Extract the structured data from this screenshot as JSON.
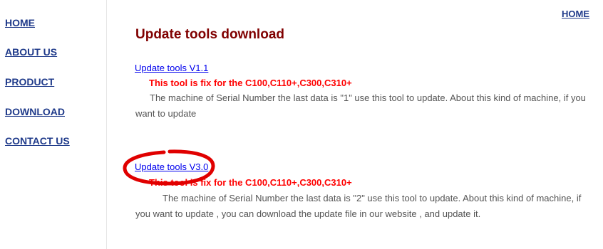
{
  "sidebar": {
    "items": [
      {
        "label": "HOME"
      },
      {
        "label": "ABOUT US"
      },
      {
        "label": "PRODUCT"
      },
      {
        "label": "DOWNLOAD"
      },
      {
        "label": "CONTACT US"
      }
    ]
  },
  "header": {
    "home_link": "HOME"
  },
  "main": {
    "title": "Update tools download",
    "downloads": [
      {
        "link": "Update tools V1.1",
        "fix": "This tool is fix for the C100,C110+,C300,C310+",
        "description": "The machine of Serial Number the last data is \"1\" use this tool to update. About this kind of machine, if you want to update"
      },
      {
        "link": "Update tools V3.0",
        "fix": "This tool is fix for the C100,C110+,C300,C310+",
        "description": "The machine of Serial Number the last data is \"2\" use this tool to update. About this kind of machine, if you want to update , you can download the update file in our website , and update it."
      }
    ]
  },
  "annotation": {
    "highlight_color": "#e00000"
  }
}
